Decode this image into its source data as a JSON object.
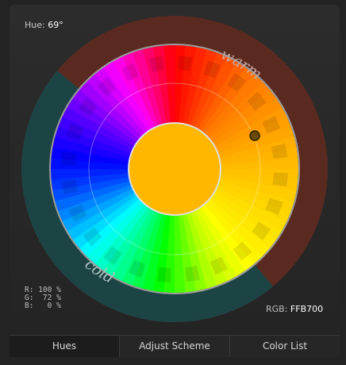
{
  "hue_readout": {
    "label": "Hue:",
    "value": "69°"
  },
  "rgb_readout": {
    "label": "RGB:",
    "value": "FFB700"
  },
  "channels": [
    {
      "name": "R:",
      "value": "100",
      "unit": "%"
    },
    {
      "name": "G:",
      "value": "72",
      "unit": "%"
    },
    {
      "name": "B:",
      "value": "0",
      "unit": "%"
    }
  ],
  "wheel": {
    "warm_label": "warm",
    "cold_label": "cold",
    "selected_color": "#FFB700",
    "warm_tint": "#5a2a20",
    "cold_tint": "#1d4444"
  },
  "tabs": [
    {
      "label": "Hues",
      "active": true
    },
    {
      "label": "Adjust Scheme",
      "active": false
    },
    {
      "label": "Color List",
      "active": false
    }
  ]
}
